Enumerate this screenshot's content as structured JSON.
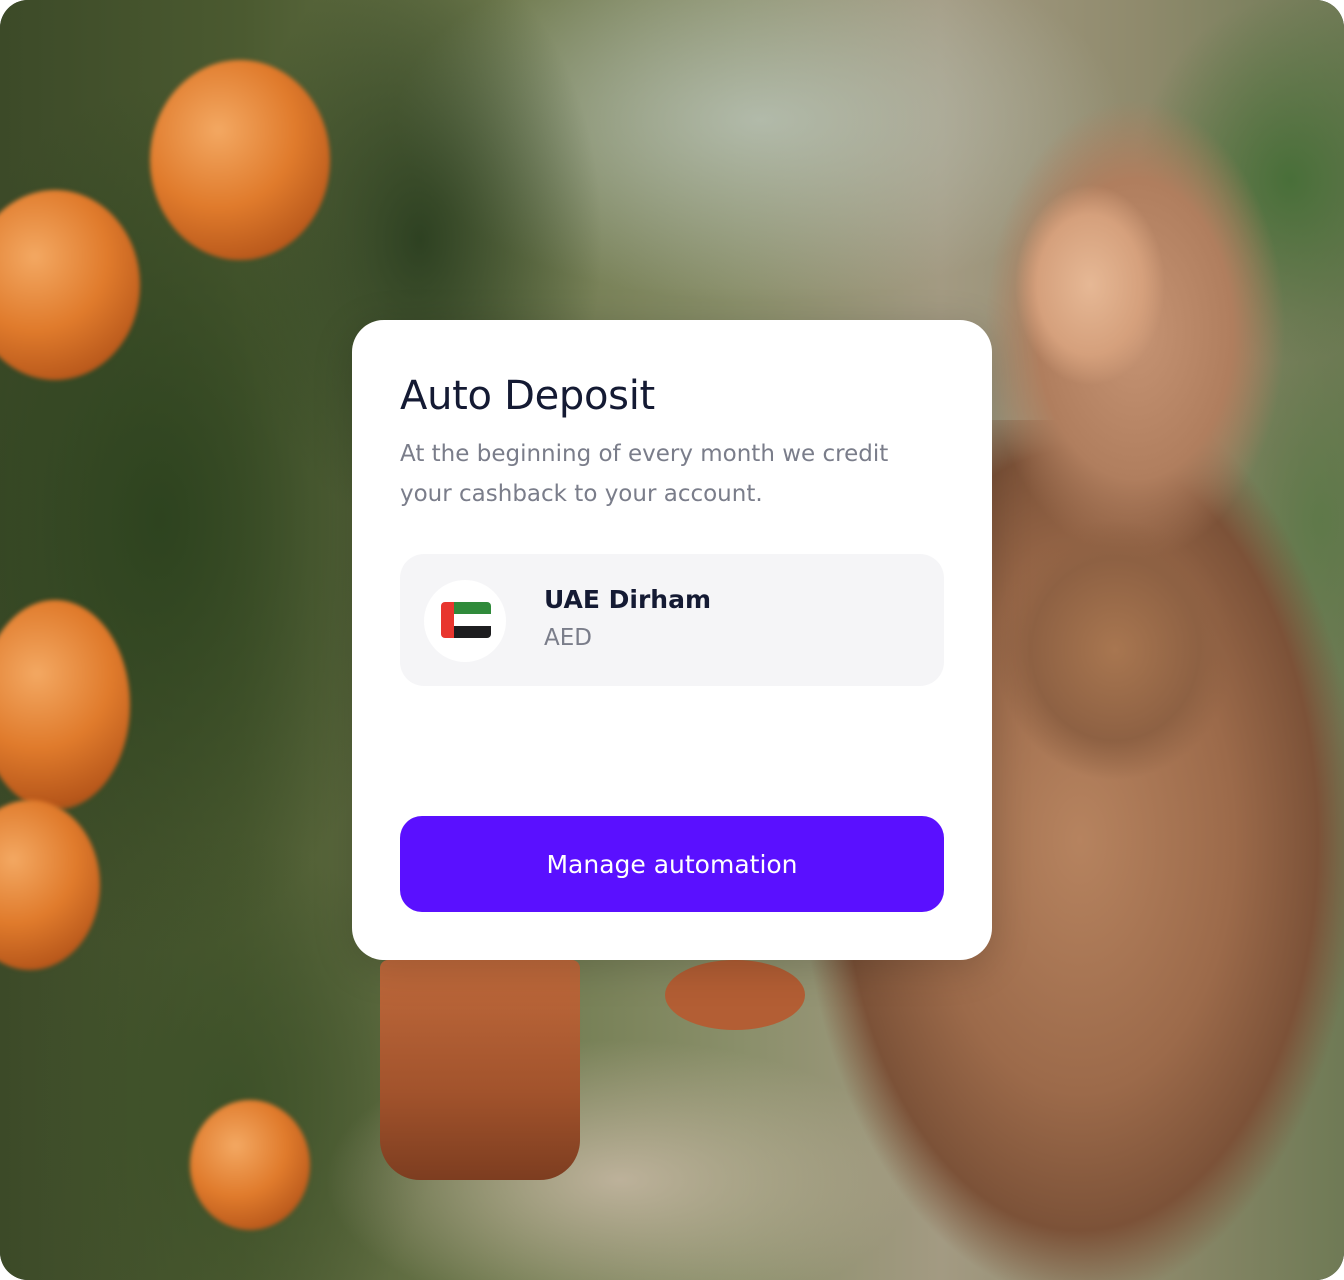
{
  "card": {
    "title": "Auto Deposit",
    "description": "At the beginning of every month we credit your cashback to your account.",
    "currency": {
      "name": "UAE Dirham",
      "code": "AED",
      "flag_icon": "uae-flag-icon"
    },
    "button_label": "Manage automation"
  },
  "colors": {
    "accent": "#5a10ff",
    "title_text": "#141a33",
    "muted_text": "#7a7d8a",
    "card_bg": "#ffffff",
    "currency_row_bg": "#f5f5f7"
  }
}
